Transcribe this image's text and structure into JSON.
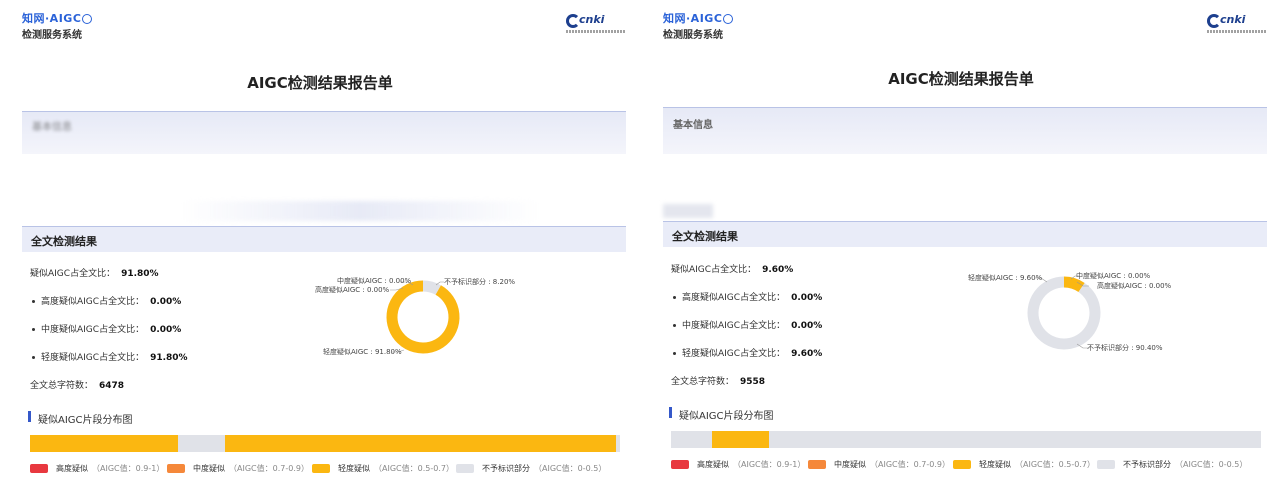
{
  "header": {
    "logo_brand": "知网·AIGC",
    "logo_system": "检测服务系统",
    "cnki_logo": "cnki"
  },
  "colors": {
    "high": "#e8383f",
    "medium": "#f5883a",
    "light": "#fbb711",
    "unmarked": "#e0e2e8",
    "accent": "#3558c9"
  },
  "legend": [
    {
      "label": "高度疑似",
      "range": "（AIGC值：0.9-1）",
      "color": "#e8383f"
    },
    {
      "label": "中度疑似",
      "range": "（AIGC值：0.7-0.9）",
      "color": "#f5883a"
    },
    {
      "label": "轻度疑似",
      "range": "（AIGC值：0.5-0.7）",
      "color": "#fbb711"
    },
    {
      "label": "不予标识部分",
      "range": "（AIGC值：0-0.5）",
      "color": "#e0e2e8"
    }
  ],
  "reports": [
    {
      "title": "AIGC检测结果报告单",
      "basic_info_label": "基本信息",
      "result_section": "全文检测结果",
      "stats": [
        {
          "label": "疑似AIGC占全文比：",
          "value": "91.80%"
        },
        {
          "label": "高度疑似AIGC占全文比：",
          "value": "0.00%"
        },
        {
          "label": "中度疑似AIGC占全文比：",
          "value": "0.00%"
        },
        {
          "label": "轻度疑似AIGC占全文比：",
          "value": "91.80%"
        }
      ],
      "char_count_label": "全文总字符数：",
      "char_count": "6478",
      "distribution_title": "疑似AIGC片段分布图",
      "chart_data": {
        "type": "pie",
        "slices": [
          {
            "name": "中度疑似AIGC",
            "value": 0.0,
            "label": "中度疑似AIGC : 0.00%"
          },
          {
            "name": "高度疑似AIGC",
            "value": 0.0,
            "label": "高度疑似AIGC : 0.00%"
          },
          {
            "name": "不予标识部分",
            "value": 8.2,
            "label": "不予标识部分 : 8.20%"
          },
          {
            "name": "轻度疑似AIGC",
            "value": 91.8,
            "label": "轻度疑似AIGC : 91.80%"
          }
        ]
      },
      "segments": [
        {
          "start": 0.0,
          "end": 0.25,
          "type": "light"
        },
        {
          "start": 0.33,
          "end": 0.993,
          "type": "light"
        }
      ]
    },
    {
      "title": "AIGC检测结果报告单",
      "basic_info_label": "基本信息",
      "result_section": "全文检测结果",
      "stats": [
        {
          "label": "疑似AIGC占全文比：",
          "value": "9.60%"
        },
        {
          "label": "高度疑似AIGC占全文比：",
          "value": "0.00%"
        },
        {
          "label": "中度疑似AIGC占全文比：",
          "value": "0.00%"
        },
        {
          "label": "轻度疑似AIGC占全文比：",
          "value": "9.60%"
        }
      ],
      "char_count_label": "全文总字符数：",
      "char_count": "9558",
      "distribution_title": "疑似AIGC片段分布图",
      "chart_data": {
        "type": "pie",
        "slices": [
          {
            "name": "轻度疑似AIGC",
            "value": 9.6,
            "label": "轻度疑似AIGC : 9.60%"
          },
          {
            "name": "中度疑似AIGC",
            "value": 0.0,
            "label": "中度疑似AIGC : 0.00%"
          },
          {
            "name": "高度疑似AIGC",
            "value": 0.0,
            "label": "高度疑似AIGC : 0.00%"
          },
          {
            "name": "不予标识部分",
            "value": 90.4,
            "label": "不予标识部分 : 90.40%"
          }
        ]
      },
      "segments": [
        {
          "start": 0.07,
          "end": 0.166,
          "type": "light"
        }
      ]
    }
  ]
}
